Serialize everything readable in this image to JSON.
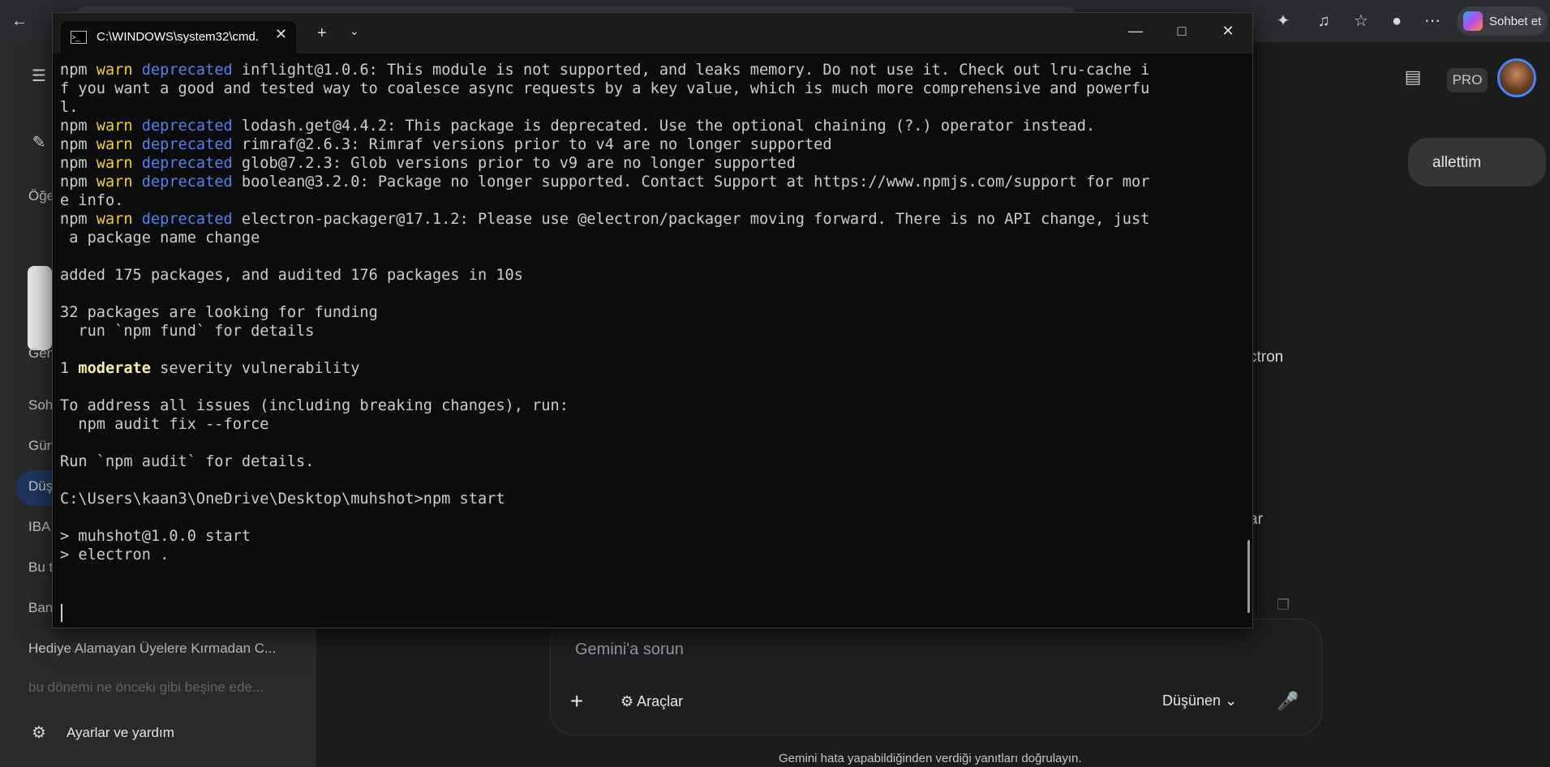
{
  "browser": {
    "sohbet_label": "Sohbet et"
  },
  "gemini": {
    "pro_badge": "PRO",
    "chip_text": "allettim",
    "right_fragments": [
      "ctron",
      "ar"
    ],
    "sidebar": {
      "items": [
        "Öğe",
        "Gen",
        "Soh",
        "Gün",
        "Düş",
        "IBA",
        "Bu t",
        "Ban",
        "Hediye Alamayan Üyelere Kırmadan C...",
        "bu dönemi ne önceki gibi beşine ede..."
      ],
      "settings_label": "Ayarlar ve yardım"
    },
    "composer": {
      "placeholder": "Gemini'a sorun",
      "tools_label": "Araçlar",
      "mode_label": "Düşünen"
    },
    "disclaimer": "Gemini hata yapabildiğinden verdiği yanıtları doğrulayın."
  },
  "cmd": {
    "tab_title": "C:\\WINDOWS\\system32\\cmd.",
    "lines": [
      [
        {
          "t": "npm "
        },
        {
          "t": "warn",
          "c": "y"
        },
        {
          "t": " "
        },
        {
          "t": "deprecated",
          "c": "b"
        },
        {
          "t": " inflight@1.0.6: This module is not supported, and leaks memory. Do not use it. Check out lru-cache i"
        }
      ],
      [
        {
          "t": "f you want a good and tested way to coalesce async requests by a key value, which is much more comprehensive and powerfu"
        }
      ],
      [
        {
          "t": "l."
        }
      ],
      [
        {
          "t": "npm "
        },
        {
          "t": "warn",
          "c": "y"
        },
        {
          "t": " "
        },
        {
          "t": "deprecated",
          "c": "b"
        },
        {
          "t": " lodash.get@4.4.2: This package is deprecated. Use the optional chaining (?.) operator instead."
        }
      ],
      [
        {
          "t": "npm "
        },
        {
          "t": "warn",
          "c": "y"
        },
        {
          "t": " "
        },
        {
          "t": "deprecated",
          "c": "b"
        },
        {
          "t": " rimraf@2.6.3: Rimraf versions prior to v4 are no longer supported"
        }
      ],
      [
        {
          "t": "npm "
        },
        {
          "t": "warn",
          "c": "y"
        },
        {
          "t": " "
        },
        {
          "t": "deprecated",
          "c": "b"
        },
        {
          "t": " glob@7.2.3: Glob versions prior to v9 are no longer supported"
        }
      ],
      [
        {
          "t": "npm "
        },
        {
          "t": "warn",
          "c": "y"
        },
        {
          "t": " "
        },
        {
          "t": "deprecated",
          "c": "b"
        },
        {
          "t": " boolean@3.2.0: Package no longer supported. Contact Support at https://www.npmjs.com/support for mor"
        }
      ],
      [
        {
          "t": "e info."
        }
      ],
      [
        {
          "t": "npm "
        },
        {
          "t": "warn",
          "c": "y"
        },
        {
          "t": " "
        },
        {
          "t": "deprecated",
          "c": "b"
        },
        {
          "t": " electron-packager@17.1.2: Please use @electron/packager moving forward. There is no API change, just"
        }
      ],
      [
        {
          "t": " a package name change"
        }
      ],
      [
        {
          "t": ""
        }
      ],
      [
        {
          "t": "added 175 packages, and audited 176 packages in 10s"
        }
      ],
      [
        {
          "t": ""
        }
      ],
      [
        {
          "t": "32 packages are looking for funding"
        }
      ],
      [
        {
          "t": "  run `npm fund` for details"
        }
      ],
      [
        {
          "t": ""
        }
      ],
      [
        {
          "t": "1 "
        },
        {
          "t": "moderate",
          "c": "yb"
        },
        {
          "t": " severity vulnerability"
        }
      ],
      [
        {
          "t": ""
        }
      ],
      [
        {
          "t": "To address all issues (including breaking changes), run:"
        }
      ],
      [
        {
          "t": "  npm audit fix --force"
        }
      ],
      [
        {
          "t": ""
        }
      ],
      [
        {
          "t": "Run `npm audit` for details."
        }
      ],
      [
        {
          "t": ""
        }
      ],
      [
        {
          "t": "C:\\Users\\kaan3\\OneDrive\\Desktop\\muhshot>npm start"
        }
      ],
      [
        {
          "t": ""
        }
      ],
      [
        {
          "t": "> muhshot@1.0.0 start"
        }
      ],
      [
        {
          "t": "> electron ."
        }
      ]
    ]
  }
}
